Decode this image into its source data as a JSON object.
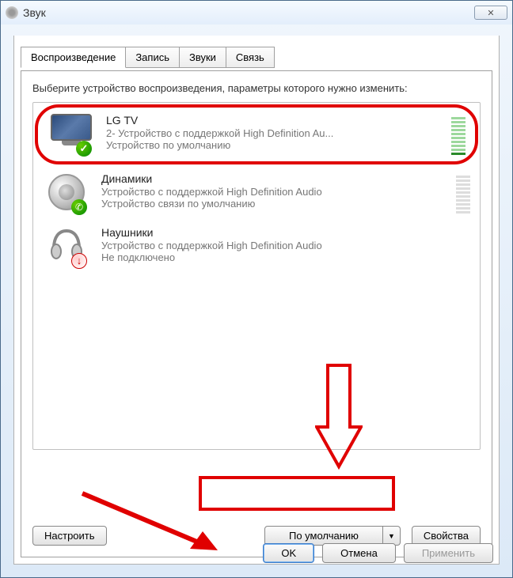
{
  "window": {
    "title": "Звук"
  },
  "tabs": [
    {
      "label": "Воспроизведение",
      "active": true
    },
    {
      "label": "Запись",
      "active": false
    },
    {
      "label": "Звуки",
      "active": false
    },
    {
      "label": "Связь",
      "active": false
    }
  ],
  "instruction": "Выберите устройство воспроизведения, параметры которого нужно изменить:",
  "devices": [
    {
      "name": "LG TV",
      "desc": "2- Устройство с поддержкой High Definition Au...",
      "status": "Устройство по умолчанию",
      "icon": "monitor",
      "badge": "check",
      "highlighted": true,
      "meter": "on"
    },
    {
      "name": "Динамики",
      "desc": "Устройство с поддержкой High Definition Audio",
      "status": "Устройство связи по умолчанию",
      "icon": "speaker",
      "badge": "phone",
      "highlighted": false,
      "meter": "on"
    },
    {
      "name": "Наушники",
      "desc": "Устройство с поддержкой High Definition Audio",
      "status": "Не подключено",
      "icon": "headphone",
      "badge": "down",
      "highlighted": false,
      "meter": "none"
    }
  ],
  "buttons": {
    "configure": "Настроить",
    "default": "По умолчанию",
    "properties": "Свойства",
    "ok": "OK",
    "cancel": "Отмена",
    "apply": "Применить"
  }
}
